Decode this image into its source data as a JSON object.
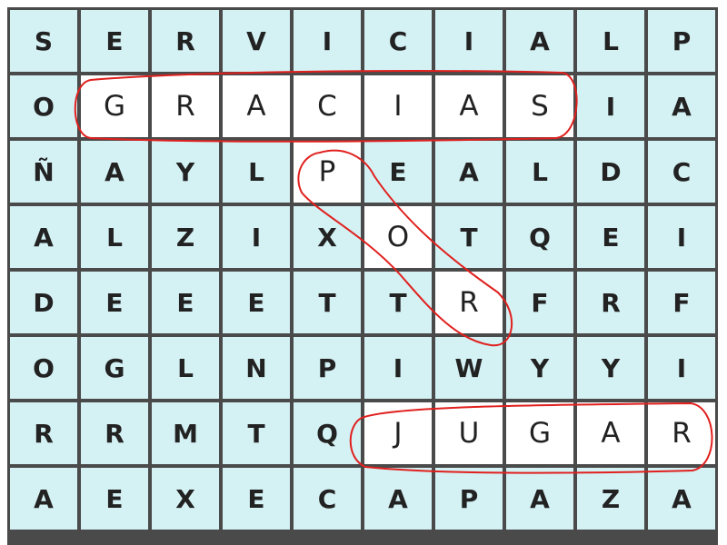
{
  "puzzle": {
    "grid": [
      [
        "S",
        "E",
        "R",
        "V",
        "I",
        "C",
        "I",
        "A",
        "L",
        "P"
      ],
      [
        "O",
        "G",
        "R",
        "A",
        "C",
        "I",
        "A",
        "S",
        "I",
        "A"
      ],
      [
        "Ñ",
        "A",
        "Y",
        "L",
        "P",
        "E",
        "A",
        "L",
        "D",
        "C"
      ],
      [
        "A",
        "L",
        "Z",
        "I",
        "X",
        "O",
        "T",
        "Q",
        "E",
        "I"
      ],
      [
        "D",
        "E",
        "E",
        "E",
        "T",
        "T",
        "R",
        "F",
        "R",
        "F"
      ],
      [
        "O",
        "G",
        "L",
        "N",
        "P",
        "I",
        "W",
        "Y",
        "Y",
        "I"
      ],
      [
        "R",
        "R",
        "M",
        "T",
        "Q",
        "J",
        "U",
        "G",
        "A",
        "R"
      ],
      [
        "A",
        "E",
        "X",
        "E",
        "C",
        "A",
        "P",
        "A",
        "Z",
        "A"
      ]
    ],
    "found_words": [
      {
        "word": "GRACIAS",
        "cells": [
          [
            1,
            1
          ],
          [
            1,
            2
          ],
          [
            1,
            3
          ],
          [
            1,
            4
          ],
          [
            1,
            5
          ],
          [
            1,
            6
          ],
          [
            1,
            7
          ]
        ]
      },
      {
        "word": "POR",
        "cells": [
          [
            2,
            4
          ],
          [
            3,
            5
          ],
          [
            4,
            6
          ]
        ]
      },
      {
        "word": "JUGAR",
        "cells": [
          [
            6,
            5
          ],
          [
            6,
            6
          ],
          [
            6,
            7
          ],
          [
            6,
            8
          ],
          [
            6,
            9
          ]
        ]
      }
    ]
  },
  "colors": {
    "cell_background": "#d4f1f4",
    "found_cell_background": "#ffffff",
    "grid_lines": "#4a4a4a",
    "circle_stroke": "#e0201e",
    "letter": "#222222"
  }
}
